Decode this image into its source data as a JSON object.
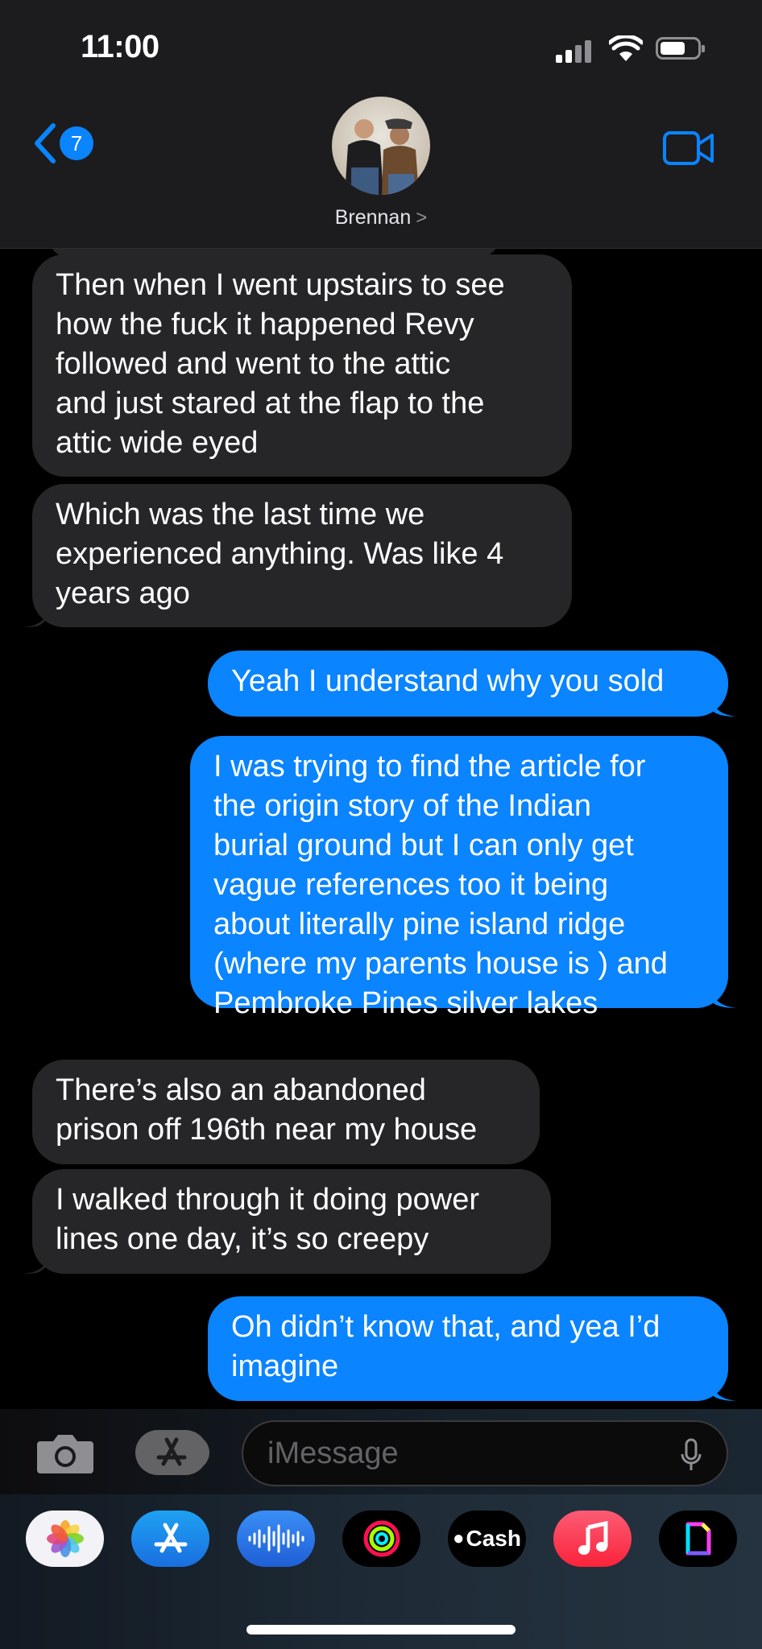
{
  "status_bar": {
    "time": "11:00"
  },
  "header": {
    "back_count": "7",
    "contact_name": "Brennan",
    "chevron": ">"
  },
  "messages": [
    {
      "from": "them",
      "text": "Then when I went upstairs to see\nhow the fuck it happened Revy\nfollowed and went to the attic\nand just stared at the flap to the\nattic wide eyed"
    },
    {
      "from": "them",
      "text": "Which was the last time we\nexperienced anything. Was like 4\nyears ago"
    },
    {
      "from": "me",
      "text": "Yeah I understand why you sold"
    },
    {
      "from": "me",
      "text": "I was trying to find the article for\nthe origin story of the Indian\nburial ground but I can only get\nvague references too it being\nabout literally pine island ridge\n(where my parents house is ) and\nPembroke Pines silver lakes"
    },
    {
      "from": "them",
      "text": "There’s also an abandoned\nprison off 196th near my house"
    },
    {
      "from": "them",
      "text": "I walked through it doing power\nlines one day, it’s so creepy"
    },
    {
      "from": "me",
      "text": "Oh didn’t know that, and yea I’d\nimagine"
    }
  ],
  "composer": {
    "placeholder": "iMessage"
  },
  "app_drawer": {
    "apps": [
      {
        "icon": "photos-icon"
      },
      {
        "icon": "app-store-icon"
      },
      {
        "icon": "audio-message-icon"
      },
      {
        "icon": "activity-icon"
      },
      {
        "icon": "apple-cash-icon",
        "label": "Cash"
      },
      {
        "icon": "music-icon"
      },
      {
        "icon": "gif-app-icon"
      }
    ]
  },
  "colors": {
    "sent": "#0a84ff",
    "received": "#262628",
    "accent": "#0a84ff"
  }
}
